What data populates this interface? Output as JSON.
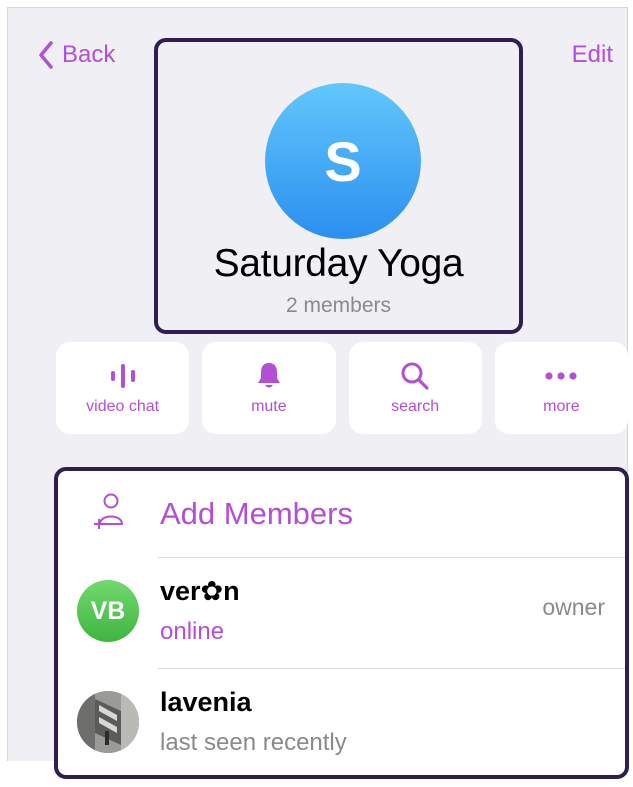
{
  "nav": {
    "back_label": "Back",
    "edit_label": "Edit"
  },
  "chat": {
    "avatar_letter": "S",
    "title": "Saturday Yoga",
    "subtitle": "2 members"
  },
  "actions": [
    {
      "label": "video chat",
      "icon": "voice-wave-icon"
    },
    {
      "label": "mute",
      "icon": "bell-icon"
    },
    {
      "label": "search",
      "icon": "search-icon"
    },
    {
      "label": "more",
      "icon": "more-dots-icon"
    }
  ],
  "members": {
    "add_label": "Add Members",
    "list": [
      {
        "initials": "VB",
        "name": "ver✿n",
        "status": "online",
        "role": "owner",
        "status_color": "#b24fd8"
      },
      {
        "initials": "",
        "name": "lavenia",
        "status": "last seen recently",
        "role": "",
        "status_color": "#8a8a8e"
      }
    ]
  },
  "colors": {
    "accent": "#b24fd8",
    "highlight_border": "#2f1f4f",
    "background": "#efeff4"
  }
}
